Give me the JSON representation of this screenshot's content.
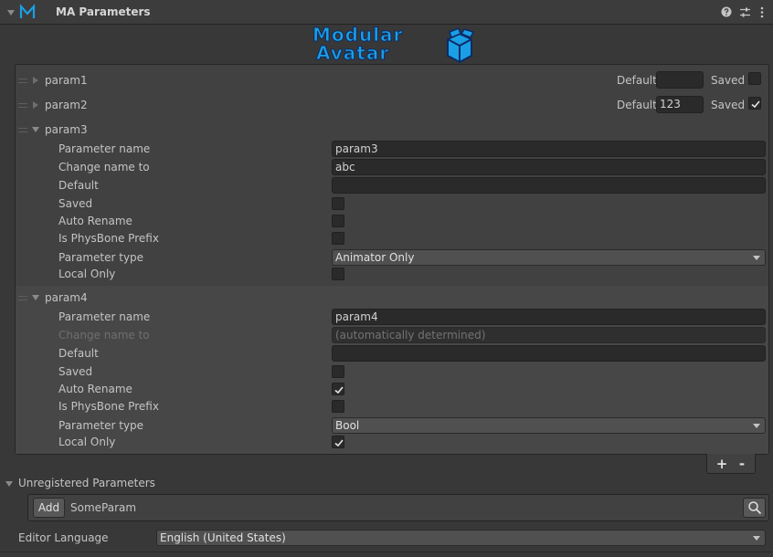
{
  "component": {
    "title": "MA Parameters"
  },
  "logo": {
    "line1": "Modular",
    "line2": "Avatar"
  },
  "params_collapsed": [
    {
      "name": "param1",
      "default_label": "Default",
      "default_value": "",
      "saved_label": "Saved",
      "saved": false
    },
    {
      "name": "param2",
      "default_label": "Default",
      "default_value": "123",
      "saved_label": "Saved",
      "saved": true
    }
  ],
  "param3": {
    "name": "param3",
    "labels": {
      "parameter_name": "Parameter name",
      "change_name_to": "Change name to",
      "default": "Default",
      "saved": "Saved",
      "auto_rename": "Auto Rename",
      "is_physbone_prefix": "Is PhysBone Prefix",
      "parameter_type": "Parameter type",
      "local_only": "Local Only"
    },
    "parameter_name": "param3",
    "change_name_to": "abc",
    "default": "",
    "saved": false,
    "auto_rename": false,
    "is_physbone_prefix": false,
    "parameter_type": "Animator Only",
    "local_only": false
  },
  "param4": {
    "name": "param4",
    "labels": {
      "parameter_name": "Parameter name",
      "change_name_to": "Change name to",
      "default": "Default",
      "saved": "Saved",
      "auto_rename": "Auto Rename",
      "is_physbone_prefix": "Is PhysBone Prefix",
      "parameter_type": "Parameter type",
      "local_only": "Local Only"
    },
    "parameter_name": "param4",
    "change_name_to": "(automatically determined)",
    "default": "",
    "saved": false,
    "auto_rename": true,
    "is_physbone_prefix": false,
    "parameter_type": "Bool",
    "local_only": true
  },
  "list_footer": {
    "add_label": "+",
    "remove_label": "-"
  },
  "unregistered": {
    "title": "Unregistered Parameters",
    "add_label": "Add",
    "param_name": "SomeParam"
  },
  "editor_language": {
    "label": "Editor Language",
    "value": "English (United States)"
  },
  "colors": {
    "accent": "#1a9fe6",
    "logo_dark": "#1a4a9a"
  }
}
